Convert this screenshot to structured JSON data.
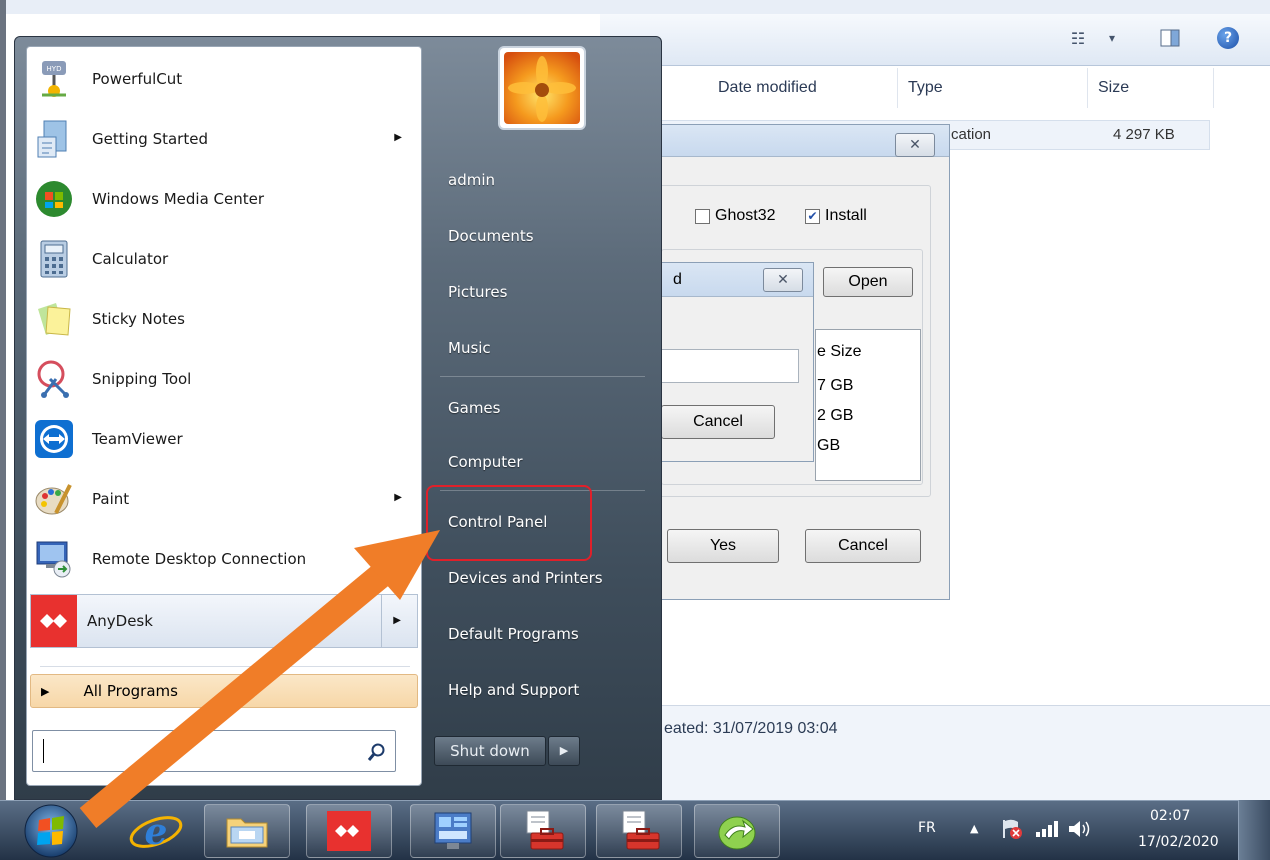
{
  "explorer": {
    "columns": [
      "Date modified",
      "Type",
      "Size"
    ],
    "file_row": {
      "type": "cation",
      "size": "4 297 KB"
    },
    "status": "eated: 31/07/2019 03:04",
    "toolbar_view_icon": "view-icon",
    "toolbar_caret": "▾",
    "help_label": "?"
  },
  "install_dialog": {
    "close_glyph": "✕",
    "checkbox_ghost32": {
      "label": "Ghost32",
      "checked": false
    },
    "checkbox_install": {
      "label": "Install",
      "checked": true
    },
    "open_label": "Open",
    "size_header": "e Size",
    "sizes": [
      "7 GB",
      "2 GB",
      "GB"
    ],
    "yes_label": "Yes",
    "cancel_label": "Cancel"
  },
  "small_dialog": {
    "title_fragment": "d",
    "close_glyph": "✕",
    "cancel_label": "Cancel"
  },
  "start_menu": {
    "programs": [
      {
        "label": "PowerfulCut",
        "icon": "powerfulcut-icon",
        "has_submenu": false
      },
      {
        "label": "Getting Started",
        "icon": "getting-started-icon",
        "has_submenu": true
      },
      {
        "label": "Windows Media Center",
        "icon": "media-center-icon",
        "has_submenu": false
      },
      {
        "label": "Calculator",
        "icon": "calculator-icon",
        "has_submenu": false
      },
      {
        "label": "Sticky Notes",
        "icon": "sticky-notes-icon",
        "has_submenu": false
      },
      {
        "label": "Snipping Tool",
        "icon": "snipping-tool-icon",
        "has_submenu": false
      },
      {
        "label": "TeamViewer",
        "icon": "teamviewer-icon",
        "has_submenu": false
      },
      {
        "label": "Paint",
        "icon": "paint-icon",
        "has_submenu": true
      },
      {
        "label": "Remote Desktop Connection",
        "icon": "remote-desktop-icon",
        "has_submenu": false
      },
      {
        "label": "AnyDesk",
        "icon": "anydesk-icon",
        "has_submenu": true
      }
    ],
    "all_programs": "All Programs",
    "search_placeholder": "",
    "right_links": [
      "admin",
      "Documents",
      "Pictures",
      "Music",
      "Games",
      "Computer",
      "Control Panel",
      "Devices and Printers",
      "Default Programs",
      "Help and Support"
    ],
    "shutdown_label": "Shut down",
    "shutdown_arrow": "▶"
  },
  "taskbar": {
    "apps": [
      "internet-explorer-icon",
      "file-explorer-icon",
      "anydesk-icon",
      "control-panel-icon",
      "toolbox-icon",
      "toolbox-icon",
      "green-arrow-app-icon"
    ],
    "language": "FR",
    "tray_caret": "▲",
    "time": "02:07",
    "date": "17/02/2020"
  },
  "colors": {
    "highlight_box": "#e0202a",
    "annotation_arrow": "#f07d28",
    "anydesk_red": "#e8312f"
  }
}
